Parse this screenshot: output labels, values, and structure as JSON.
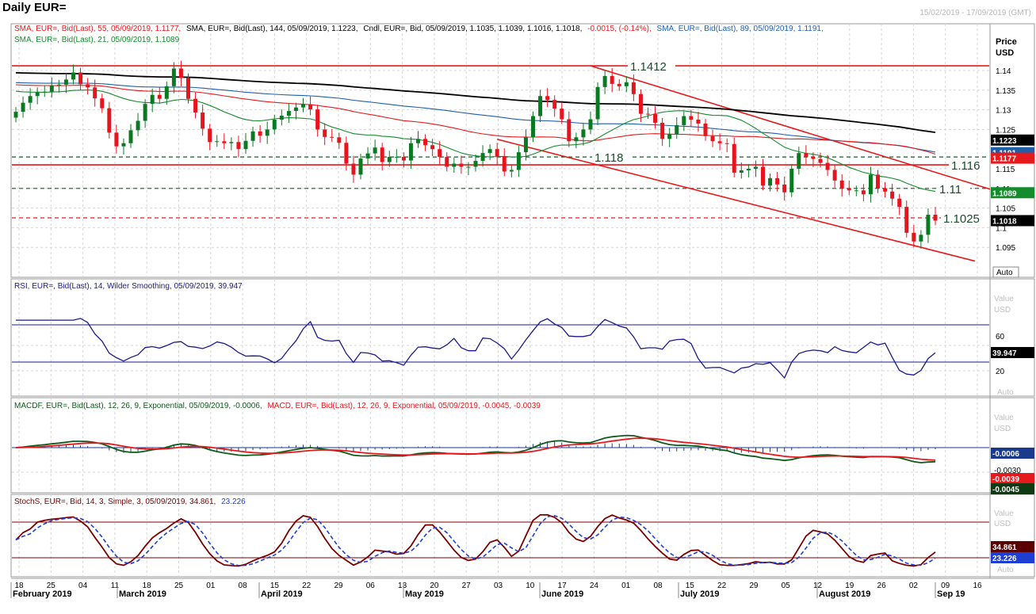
{
  "title": "Daily EUR=",
  "date_range": "15/02/2019 - 17/09/2019 (GMT)",
  "colors": {
    "candle_up": "#0a7a22",
    "candle_down": "#e8141c",
    "sma55": "#e41a1c",
    "sma144": "#000000",
    "sma89": "#1f5fa8",
    "sma21": "#138c2b",
    "rsi": "#1a1a8c",
    "macd_line": "#0f5a1a",
    "macd_signal": "#e41a1c",
    "hist": "#1a3a8c",
    "stoch_k": "#7a0000",
    "stoch_d": "#1f3fd4",
    "trend": "#e41a1c",
    "hline_red": "#e41a1c",
    "grid": "#d6d6d6"
  },
  "legends": {
    "price_red": "SMA, EUR=, Bid(Last),   55, 05/09/2019, 1.1177,",
    "price_black": "SMA, EUR=, Bid(Last),   144, 05/09/2019, 1.1223,",
    "price_cndl": "Cndl, EUR=, Bid,  05/09/2019, 1.1035, 1.1039, 1.1016, 1.1018,",
    "price_chg": "-0.0015, (-0.14%),",
    "price_blue": "SMA, EUR=, Bid(Last),   89, 05/09/2019, 1.1191,",
    "price_green": "SMA, EUR=, Bid(Last),   21, 05/09/2019, 1.1089",
    "rsi": "RSI, EUR=, Bid(Last),   14, Wilder Smoothing,  05/09/2019, 39.947",
    "macd_green": "MACDF, EUR=, Bid(Last),   12, 26, 9, Exponential,  05/09/2019, -0.0006,",
    "macd_red": "MACD, EUR=, Bid(Last),   12, 26, 9, Exponential,  05/09/2019, -0.0045, -0.0039",
    "stoch_brown": "StochS, EUR=, Bid,   14, 3, Simple, 3,  05/09/2019, 34.861,",
    "stoch_blue": "23.226"
  },
  "axis": {
    "price_header": [
      "Price",
      "USD"
    ],
    "value_header": [
      "Value",
      "USD"
    ],
    "auto": "Auto",
    "price_ticks": [
      "1.14",
      "1.135",
      "1.13",
      "1.125",
      "1.115",
      "1.11",
      "1.105",
      "1.1",
      "1.095"
    ],
    "rsi_ticks": [
      "60",
      "20"
    ],
    "macd_ticks": [
      "-0.0030"
    ],
    "stoch_ticks": [
      "USD"
    ]
  },
  "price_tags": [
    {
      "value": 1.1223,
      "label": "1.1223",
      "color": "#000000"
    },
    {
      "value": 1.1191,
      "label": "1.1191",
      "color": "#1f5fa8"
    },
    {
      "value": 1.1177,
      "label": "1.1177",
      "color": "#e41a1c"
    },
    {
      "value": 1.1089,
      "label": "1.1089",
      "color": "#138c2b"
    },
    {
      "value": 1.1018,
      "label": "1.1018",
      "color": "#000000"
    }
  ],
  "indicator_tags": {
    "rsi": "39.947",
    "macdf": "-0.0006",
    "macd_signal": "-0.0039",
    "macd": "-0.0045",
    "stoch_k": "34.861",
    "stoch_d": "23.226"
  },
  "levels": [
    {
      "value": 1.1412,
      "label": "1.1412",
      "style": "solid"
    },
    {
      "value": 1.118,
      "label": "1.118",
      "style": "dashed"
    },
    {
      "value": 1.116,
      "label": "1.116",
      "style": "solid"
    },
    {
      "value": 1.11,
      "label": "1.11",
      "style": "dashed"
    },
    {
      "value": 1.1025,
      "label": "1.1025",
      "style": "dashed-red"
    }
  ],
  "x_ticks": [
    "18",
    "25",
    "04",
    "11",
    "18",
    "25",
    "01",
    "08",
    "15",
    "22",
    "29",
    "06",
    "13",
    "20",
    "27",
    "03",
    "10",
    "17",
    "24",
    "01",
    "08",
    "15",
    "22",
    "29",
    "05",
    "12",
    "19",
    "26",
    "02",
    "09",
    "16"
  ],
  "months": [
    "February 2019",
    "March 2019",
    "April 2019",
    "May 2019",
    "June 2019",
    "July 2019",
    "August 2019",
    "Sep 19"
  ],
  "chart_data": {
    "type": "candlestick",
    "instrument": "EUR=",
    "period": "Daily",
    "x_range": [
      "2019-02-15",
      "2019-09-17"
    ],
    "price_axis": {
      "ylim": [
        1.091,
        1.1465
      ],
      "ticks": [
        1.095,
        1.1,
        1.105,
        1.11,
        1.115,
        1.125,
        1.13,
        1.135,
        1.14
      ]
    },
    "last_candle": {
      "date": "2019-09-05",
      "open": 1.1035,
      "high": 1.1039,
      "low": 1.1016,
      "close": 1.1018,
      "change": -0.0015,
      "change_pct": -0.14
    },
    "candles_close": [
      1.1295,
      1.1318,
      1.1335,
      1.1345,
      1.1346,
      1.1362,
      1.1364,
      1.1377,
      1.1395,
      1.1365,
      1.1357,
      1.1329,
      1.1304,
      1.1242,
      1.1207,
      1.1215,
      1.1248,
      1.1272,
      1.1315,
      1.1338,
      1.1328,
      1.136,
      1.1405,
      1.1381,
      1.1328,
      1.1293,
      1.1252,
      1.1218,
      1.122,
      1.1215,
      1.1218,
      1.12,
      1.1221,
      1.1245,
      1.1234,
      1.125,
      1.1275,
      1.1285,
      1.1297,
      1.1306,
      1.1314,
      1.1301,
      1.125,
      1.1231,
      1.123,
      1.1216,
      1.1163,
      1.1135,
      1.1176,
      1.1189,
      1.1204,
      1.1167,
      1.118,
      1.118,
      1.1171,
      1.1215,
      1.1226,
      1.121,
      1.12,
      1.118,
      1.1155,
      1.1163,
      1.1155,
      1.1155,
      1.117,
      1.119,
      1.12,
      1.1182,
      1.1143,
      1.1147,
      1.1192,
      1.123,
      1.1284,
      1.1335,
      1.1325,
      1.1303,
      1.1276,
      1.122,
      1.123,
      1.125,
      1.1276,
      1.1358,
      1.1386,
      1.1366,
      1.136,
      1.137,
      1.134,
      1.129,
      1.1289,
      1.1267,
      1.1226,
      1.1238,
      1.1261,
      1.1284,
      1.1275,
      1.1265,
      1.1233,
      1.122,
      1.1215,
      1.1213,
      1.114,
      1.1146,
      1.115,
      1.1155,
      1.1107,
      1.1126,
      1.111,
      1.109,
      1.115,
      1.119,
      1.118,
      1.1175,
      1.1165,
      1.1147,
      1.112,
      1.11,
      1.1095,
      1.1095,
      1.1085,
      1.1135,
      1.11,
      1.1092,
      1.1074,
      1.1053,
      1.0987,
      1.0965,
      1.0982,
      1.1033,
      1.1018
    ],
    "sma_144": {
      "name": "SMA 144",
      "last": 1.1223
    },
    "sma_89": {
      "name": "SMA 89",
      "last": 1.1191
    },
    "sma_55": {
      "name": "SMA 55",
      "last": 1.1177
    },
    "sma_21": {
      "name": "SMA 21",
      "last": 1.1089
    },
    "rsi": {
      "period": 14,
      "last": 39.947,
      "levels": [
        70,
        30
      ],
      "ticks": [
        60,
        20
      ]
    },
    "macd": {
      "fast": 12,
      "slow": 26,
      "signal": 9,
      "histogram_last": -0.0006,
      "macd_last": -0.0045,
      "signal_last": -0.0039
    },
    "stochastic": {
      "k": 14,
      "d": 3,
      "smooth": 3,
      "k_last": 34.861,
      "d_last": 23.226,
      "levels": [
        80,
        20
      ]
    }
  }
}
